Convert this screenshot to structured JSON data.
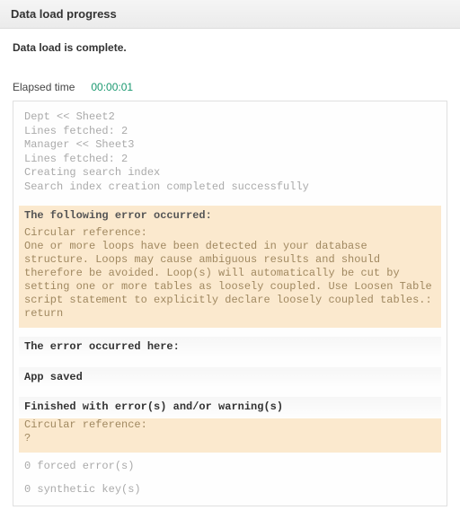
{
  "header": {
    "title": "Data load progress"
  },
  "status": {
    "message": "Data load is complete."
  },
  "elapsed": {
    "label": "Elapsed time",
    "value": "00:00:01"
  },
  "log": {
    "lines": [
      "Dept << Sheet2",
      "Lines fetched: 2",
      "Manager << Sheet3",
      "Lines fetched: 2",
      "Creating search index",
      "Search index creation completed successfully"
    ]
  },
  "error1": {
    "heading": "The following error occurred:",
    "title": "Circular reference:",
    "body": "One or more loops have been detected in your database structure. Loops may cause ambiguous results and should therefore be avoided. Loop(s) will automatically be cut by setting one or more tables as loosely coupled. Use Loosen Table script statement to explicitly declare loosely coupled tables.: return"
  },
  "error_here": {
    "heading": "The error occurred here:"
  },
  "app_saved": {
    "heading": "App saved"
  },
  "finished": {
    "heading": "Finished with error(s) and/or warning(s)"
  },
  "error2": {
    "title": "Circular reference:",
    "body": "?"
  },
  "summary": {
    "forced": "0 forced error(s)",
    "synthetic": "0 synthetic key(s)"
  }
}
